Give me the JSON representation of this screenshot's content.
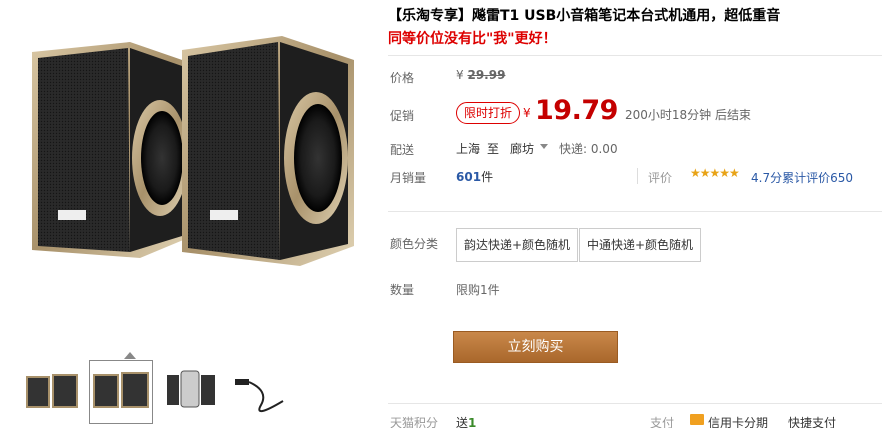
{
  "product": {
    "title_line1": "【乐淘专享】飚雷T1 USB小音箱笔记本台式机通用，超低重音",
    "title_line2": "同等价位没有比\"我\"更好！"
  },
  "price": {
    "label": "价格",
    "currency": "¥",
    "original": "29.99"
  },
  "promotion": {
    "label": "促销",
    "badge": "限时打折",
    "currency": "¥",
    "price": "19.79",
    "countdown": "200小时18分钟 后结束"
  },
  "shipping": {
    "label": "配送",
    "from": "上海",
    "to_word": "至",
    "destination": "廊坊",
    "fee": "快递: 0.00"
  },
  "sales": {
    "label": "月销量",
    "count": "601",
    "unit": "件",
    "rating_label": "评价",
    "stars": "★★★★★",
    "rating_text": "4.7分累计评价650",
    "rating_value": 4.7
  },
  "color": {
    "label": "颜色分类",
    "options": [
      "韵达快递+颜色随机",
      "中通快递+颜色随机"
    ]
  },
  "quantity": {
    "label": "数量",
    "limit": "限购1件"
  },
  "buy_button": "立刻购买",
  "bottom": {
    "points_label": "天猫积分",
    "points_text": "送",
    "points_value": "1",
    "pay_label": "支付",
    "credit_card": "信用卡分期",
    "express_pay": "快捷支付"
  },
  "colors": {
    "accent_red": "#c40000",
    "link_blue": "#2b59a6",
    "buy_button": "#b87333"
  }
}
